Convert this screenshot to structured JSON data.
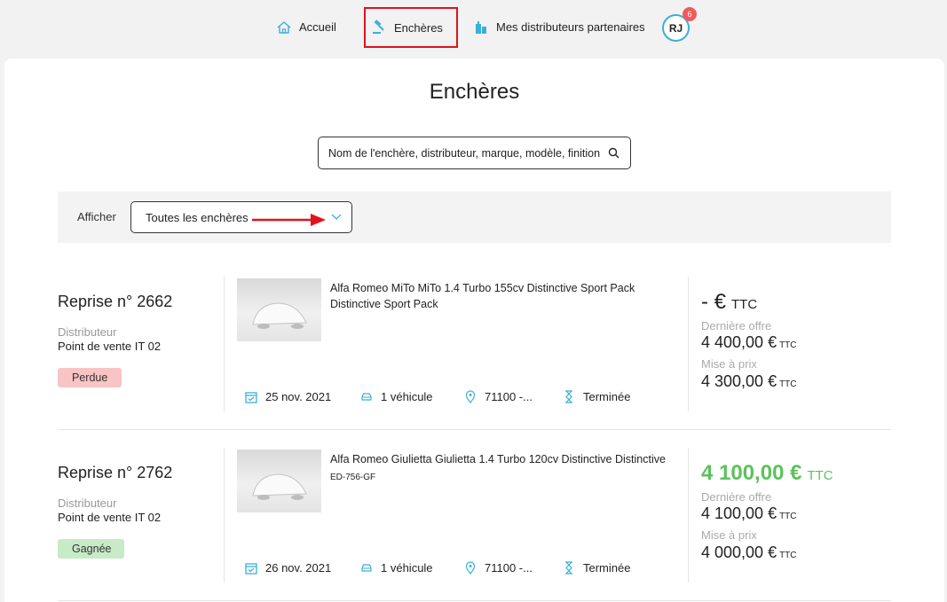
{
  "nav": {
    "items": [
      {
        "label": "Accueil",
        "icon": "home-icon"
      },
      {
        "label": "Enchères",
        "icon": "gavel-icon"
      },
      {
        "label": "Mes distributeurs partenaires",
        "icon": "buildings-icon"
      }
    ],
    "avatar_initials": "RJ",
    "notification_count": "6"
  },
  "page": {
    "title": "Enchères",
    "search_placeholder": "Nom de l'enchère, distributeur, marque, modèle, finition"
  },
  "filter": {
    "label": "Afficher",
    "selected": "Toutes les enchères"
  },
  "listings": [
    {
      "title": "Reprise n° 2662",
      "distributor_label": "Distributeur",
      "distributor": "Point de vente IT 02",
      "status": "Perdue",
      "vehicle": "Alfa Romeo MiTo MiTo 1.4 Turbo 155cv Distinctive Sport Pack",
      "vehicle_sub": "Distinctive Sport Pack",
      "date": "25 nov. 2021",
      "vehicles_count": "1 véhicule",
      "location": "71100 -...",
      "state": "Terminée",
      "price": "- €",
      "price_unit": "TTC",
      "last_offer_label": "Dernière offre",
      "last_offer": "4 400,00 €",
      "start_price_label": "Mise à prix",
      "start_price": "4 300,00 €",
      "unit_small": "TTC"
    },
    {
      "title": "Reprise n° 2762",
      "distributor_label": "Distributeur",
      "distributor": "Point de vente IT 02",
      "status": "Gagnée",
      "vehicle": "Alfa Romeo Giulietta Giulietta 1.4 Turbo 120cv Distinctive Distinctive",
      "vehicle_sub": "ED-756-GF",
      "date": "26 nov. 2021",
      "vehicles_count": "1 véhicule",
      "location": "71100 -...",
      "state": "Terminée",
      "price": "4 100,00 €",
      "price_unit": "TTC",
      "last_offer_label": "Dernière offre",
      "last_offer": "4 100,00 €",
      "start_price_label": "Mise à prix",
      "start_price": "4 000,00 €",
      "unit_small": "TTC"
    }
  ],
  "colors": {
    "accent": "#3ab0d6",
    "won": "#5cc25c",
    "lost_badge": "#f8c4c4",
    "won_badge": "#c6ebc6",
    "highlight": "#e0121b"
  }
}
